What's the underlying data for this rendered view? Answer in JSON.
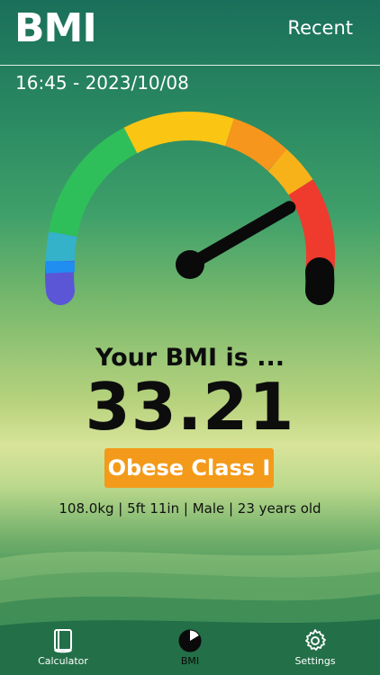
{
  "header": {
    "title": "BMI",
    "recent_label": "Recent"
  },
  "datetime": "16:45 - 2023/10/08",
  "result": {
    "heading": "Your BMI is ...",
    "value": "33.21",
    "category": "Obese Class I",
    "details": "108.0kg | 5ft 11in | Male | 23 years old"
  },
  "gauge": {
    "needle_fraction": 0.8,
    "colors": {
      "purple": "#5b56d6",
      "blue": "#1f8ef0",
      "cyan": "#33b2c9",
      "green": "#2fbf5a",
      "yellow": "#fbc514",
      "orange": "#f7961c",
      "light_orange": "#f7b21a",
      "red": "#ef3a2e",
      "black": "#0a0a0a"
    }
  },
  "tabs": [
    {
      "label": "Calculator",
      "icon": "book-icon"
    },
    {
      "label": "BMI",
      "icon": "pie-chart-icon"
    },
    {
      "label": "Settings",
      "icon": "gear-icon"
    }
  ],
  "colors": {
    "accent": "#f39a1a",
    "text_dark": "#0d0d0d",
    "white": "#ffffff"
  }
}
